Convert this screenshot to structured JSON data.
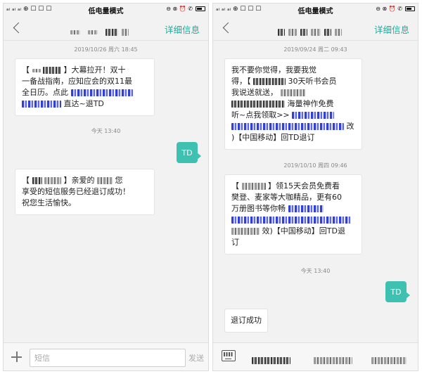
{
  "status_bar": {
    "title": "低电量模式",
    "left_icons": "ₐᵢ ₐᵢ ₐᵢ ⊕ ☐ ☐ ☐",
    "right_icons": "⊖ ⊗ ⏰ ✆"
  },
  "left": {
    "header": {
      "detail_label": "详细信息"
    },
    "messages": {
      "ts1": "2019/10/26 周六 18:45",
      "msg1": {
        "bracket_open": "【",
        "bracket_close": "】",
        "line1_text": "大幕拉开！双十",
        "line2_text": "一备战指南，应知应会的双11最",
        "line3_text": "全日历。点此",
        "line4_text": "直达~退TD"
      },
      "out1": "TD",
      "ts2": "今天 13:40",
      "msg2": {
        "line1_open": "【",
        "line1_close": "】亲爱的",
        "line1_end": "您",
        "line2_text": "享受的短信服务已经退订成功！",
        "line3_text": "祝您生活愉快。"
      }
    },
    "input": {
      "placeholder": "短信",
      "send_label": "发送"
    }
  },
  "right": {
    "header": {
      "detail_label": "详细信息"
    },
    "messages": {
      "ts1": "2019/09/24 周二 09:43",
      "msg1": {
        "line1_text": "我不要你觉得，我要我觉",
        "line2_a": "得，【",
        "line2_b": "30天听书会员",
        "line3_a": "我说送就送，",
        "line4_b": "海量神作免费",
        "line5_a": "听~点我领取>>",
        "line6_b": "改",
        "line7_text": ")【中国移动】回TD退订"
      },
      "ts2": "2019/10/10 周四 09:46",
      "msg2": {
        "line1_a": "【",
        "line1_b": "】领15天会员免费看",
        "line2_text": "樊登、麦家等大咖精品，更有60",
        "line3_a": "万册图书等你畅",
        "line5_b": "效)【中国移动】回TD退",
        "line6_text": "订"
      },
      "ts3": "今天 13:40",
      "out1": "TD",
      "msg3": "退订成功"
    }
  }
}
